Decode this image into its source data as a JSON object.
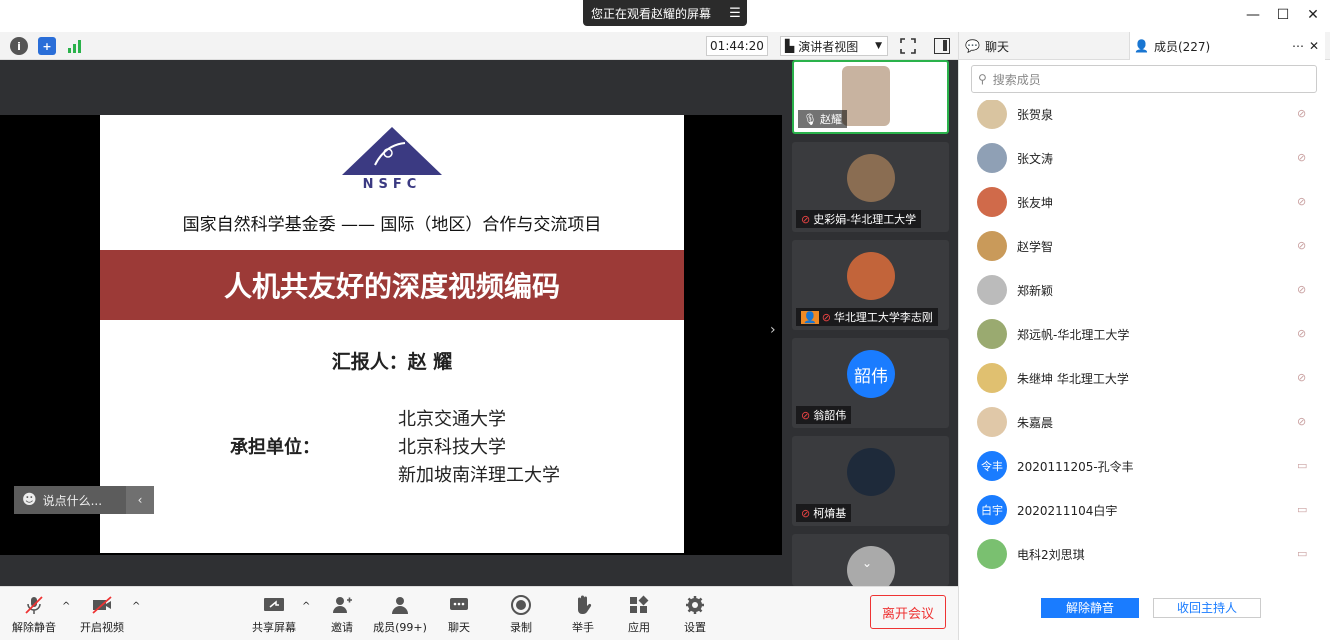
{
  "window": {
    "share_banner": "您正在观看赵耀的屏幕",
    "minimize": "—",
    "maximize": "☐",
    "close": "✕"
  },
  "topbar": {
    "timer": "01:44:20",
    "view_label": "演讲者视图"
  },
  "slide": {
    "logo_text": "NSFC",
    "subtitle": "国家自然科学基金委 —— 国际（地区）合作与交流项目",
    "title": "人机共友好的深度视频编码",
    "reporter": "汇报人：赵 耀",
    "unit_label": "承担单位：",
    "universities": [
      "北京交通大学",
      "北京科技大学",
      "新加坡南洋理工大学"
    ]
  },
  "chat_input": {
    "placeholder": "说点什么..."
  },
  "thumbnails": [
    {
      "name": "赵耀",
      "color": "#d8c9b6"
    },
    {
      "name": "史彩娟-华北理工大学",
      "color": "#8a6d52"
    },
    {
      "name": "华北理工大学李志刚",
      "color": "#c2643a"
    },
    {
      "name": "翁韶伟",
      "initials": "韶伟",
      "color": "#1a7cff"
    },
    {
      "name": "柯焴基",
      "color": "#1e2a3a"
    }
  ],
  "panel": {
    "chat_tab": "聊天",
    "members_tab": "成员(227)",
    "search_placeholder": "搜索成员",
    "members": [
      {
        "name": "张贺泉",
        "color": "#d9c4a0"
      },
      {
        "name": "张文涛",
        "color": "#8fa0b5"
      },
      {
        "name": "张友坤",
        "color": "#d06a4a"
      },
      {
        "name": "赵学智",
        "color": "#c99a5a"
      },
      {
        "name": "郑新颖",
        "color": "#bbbbbb"
      },
      {
        "name": "郑远帆-华北理工大学",
        "color": "#9aaa70"
      },
      {
        "name": "朱继坤 华北理工大学",
        "color": "#e0c070"
      },
      {
        "name": "朱嘉晨",
        "color": "#e0c8a8"
      },
      {
        "name": "2020111205-孔令丰",
        "initials": "令丰",
        "color": "#1a7cff"
      },
      {
        "name": "2020211104白宇",
        "initials": "白宇",
        "color": "#1a7cff"
      },
      {
        "name": "电科2刘思琪",
        "color": "#7ac070"
      }
    ],
    "unmute_all": "解除静音",
    "reclaim_host": "收回主持人"
  },
  "toolbar": {
    "unmute": "解除静音",
    "start_video": "开启视频",
    "share_screen": "共享屏幕",
    "invite": "邀请",
    "members": "成员(99+)",
    "chat": "聊天",
    "record": "录制",
    "raise_hand": "举手",
    "apps": "应用",
    "settings": "设置",
    "leave": "离开会议"
  }
}
